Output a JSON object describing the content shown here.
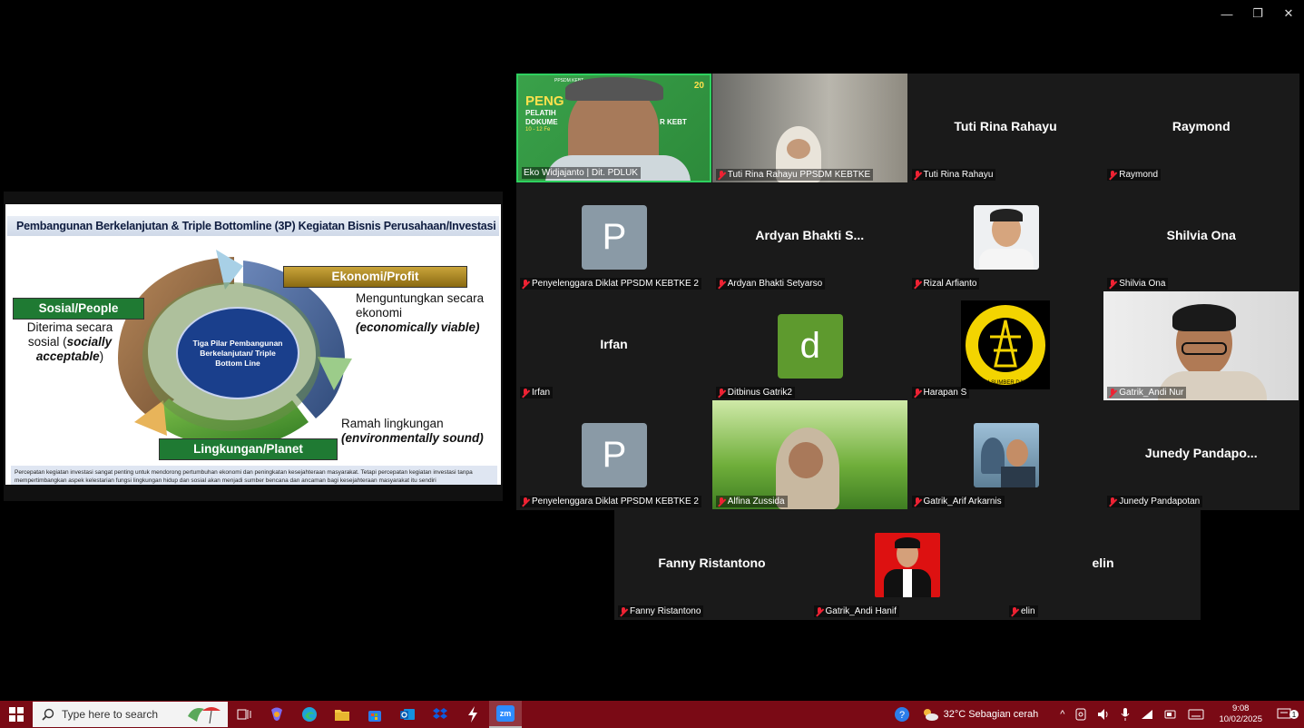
{
  "window": {
    "controls": [
      "—",
      "❐",
      "✕"
    ]
  },
  "slide": {
    "title": "Pembangunan Berkelanjutan & Triple Bottomline (3P) Kegiatan Bisnis Perusahaan/Investasi",
    "pill_social": "Sosial/People",
    "pill_profit": "Ekonomi/Profit",
    "pill_planet": "Lingkungan/Planet",
    "social_line1": "Diterima secara",
    "social_line2": "sosial (",
    "social_italic1": "socially",
    "social_italic2": "acceptable",
    "social_close": ")",
    "profit_line1": "Menguntungkan secara",
    "profit_line2": "ekonomi",
    "profit_italic": "(economically viable)",
    "planet_line1": "Ramah lingkungan",
    "planet_italic": "(environmentally sound)",
    "center": "Tiga Pilar Pembangunan Berkelanjutan/ Triple Bottom Line",
    "note": "Percepatan kegiatan investasi sangat penting untuk mendorong pertumbuhan ekonomi dan peningkatan kesejahteraan masyarakat. Tetapi percepatan kegiatan investasi tanpa mempertimbangkan aspek kelestarian fungsi lingkungan hidup dan sosial akan menjadi sumber bencana dan ancaman bagi kesejahteraan masyarakat itu sendiri"
  },
  "participants": [
    {
      "label": "Eko Widjajanto | Dit. PDLUK",
      "muted": false,
      "type": "video-speaker",
      "banner": "PENG",
      "banner2": "PELATIH",
      "banner3": "AN",
      "banner4": "DOKUME",
      "banner5": "R KEBT",
      "banner6": "10 - 12 Fe",
      "logo": "PPSDM KEBT",
      "logo2": "20"
    },
    {
      "label": "Tuti Rina Rahayu PPSDM KEBTKE",
      "muted": true,
      "type": "video-room"
    },
    {
      "label": "Tuti Rina Rahayu",
      "muted": true,
      "type": "name",
      "big": "Tuti Rina Rahayu"
    },
    {
      "label": "Raymond",
      "muted": true,
      "type": "name",
      "big": "Raymond"
    },
    {
      "label": "Penyelenggara Diklat PPSDM KEBTKE 2",
      "muted": true,
      "type": "letter",
      "letter": "P",
      "color": "#8a9aa6"
    },
    {
      "label": "Ardyan Bhakti Setyarso",
      "muted": true,
      "type": "name",
      "big": "Ardyan Bhakti S..."
    },
    {
      "label": "Rizal Arfianto",
      "muted": true,
      "type": "photo-man"
    },
    {
      "label": "Shilvia Ona",
      "muted": true,
      "type": "name",
      "big": "Shilvia Ona"
    },
    {
      "label": "Irfan",
      "muted": true,
      "type": "name",
      "big": "Irfan"
    },
    {
      "label": "Ditbinus Gatrik2",
      "muted": true,
      "type": "letter",
      "letter": "d",
      "color": "#5e9a2e"
    },
    {
      "label": "Harapan S",
      "muted": true,
      "type": "logo-esdm",
      "logo_text": "ENERGI DAN SUMBER DAYA MINERAL"
    },
    {
      "label": "Gatrik_Andi Nur",
      "muted": true,
      "type": "video-man"
    },
    {
      "label": "Penyelenggara Diklat PPSDM KEBTKE 2",
      "muted": true,
      "type": "letter",
      "letter": "P",
      "color": "#8a9aa6"
    },
    {
      "label": "Alfina Zussida",
      "muted": true,
      "type": "video-grass"
    },
    {
      "label": "Gatrik_Arif Arkarnis",
      "muted": true,
      "type": "photo-couple"
    },
    {
      "label": "Junedy Pandapotan",
      "muted": true,
      "type": "name",
      "big": "Junedy  Pandapo..."
    }
  ],
  "participants_row5": [
    {
      "label": "Fanny Ristantono",
      "muted": true,
      "type": "name",
      "big": "Fanny Ristantono"
    },
    {
      "label": "Gatrik_Andi Hanif",
      "muted": true,
      "type": "photo-id"
    },
    {
      "label": "elin",
      "muted": true,
      "type": "name",
      "big": "elin"
    }
  ],
  "taskbar": {
    "search_placeholder": "Type here to search",
    "weather": "32°C  Sebagian cerah",
    "time": "9:08",
    "date": "10/02/2025",
    "notif_count": "1",
    "app_zoom": "zm"
  }
}
